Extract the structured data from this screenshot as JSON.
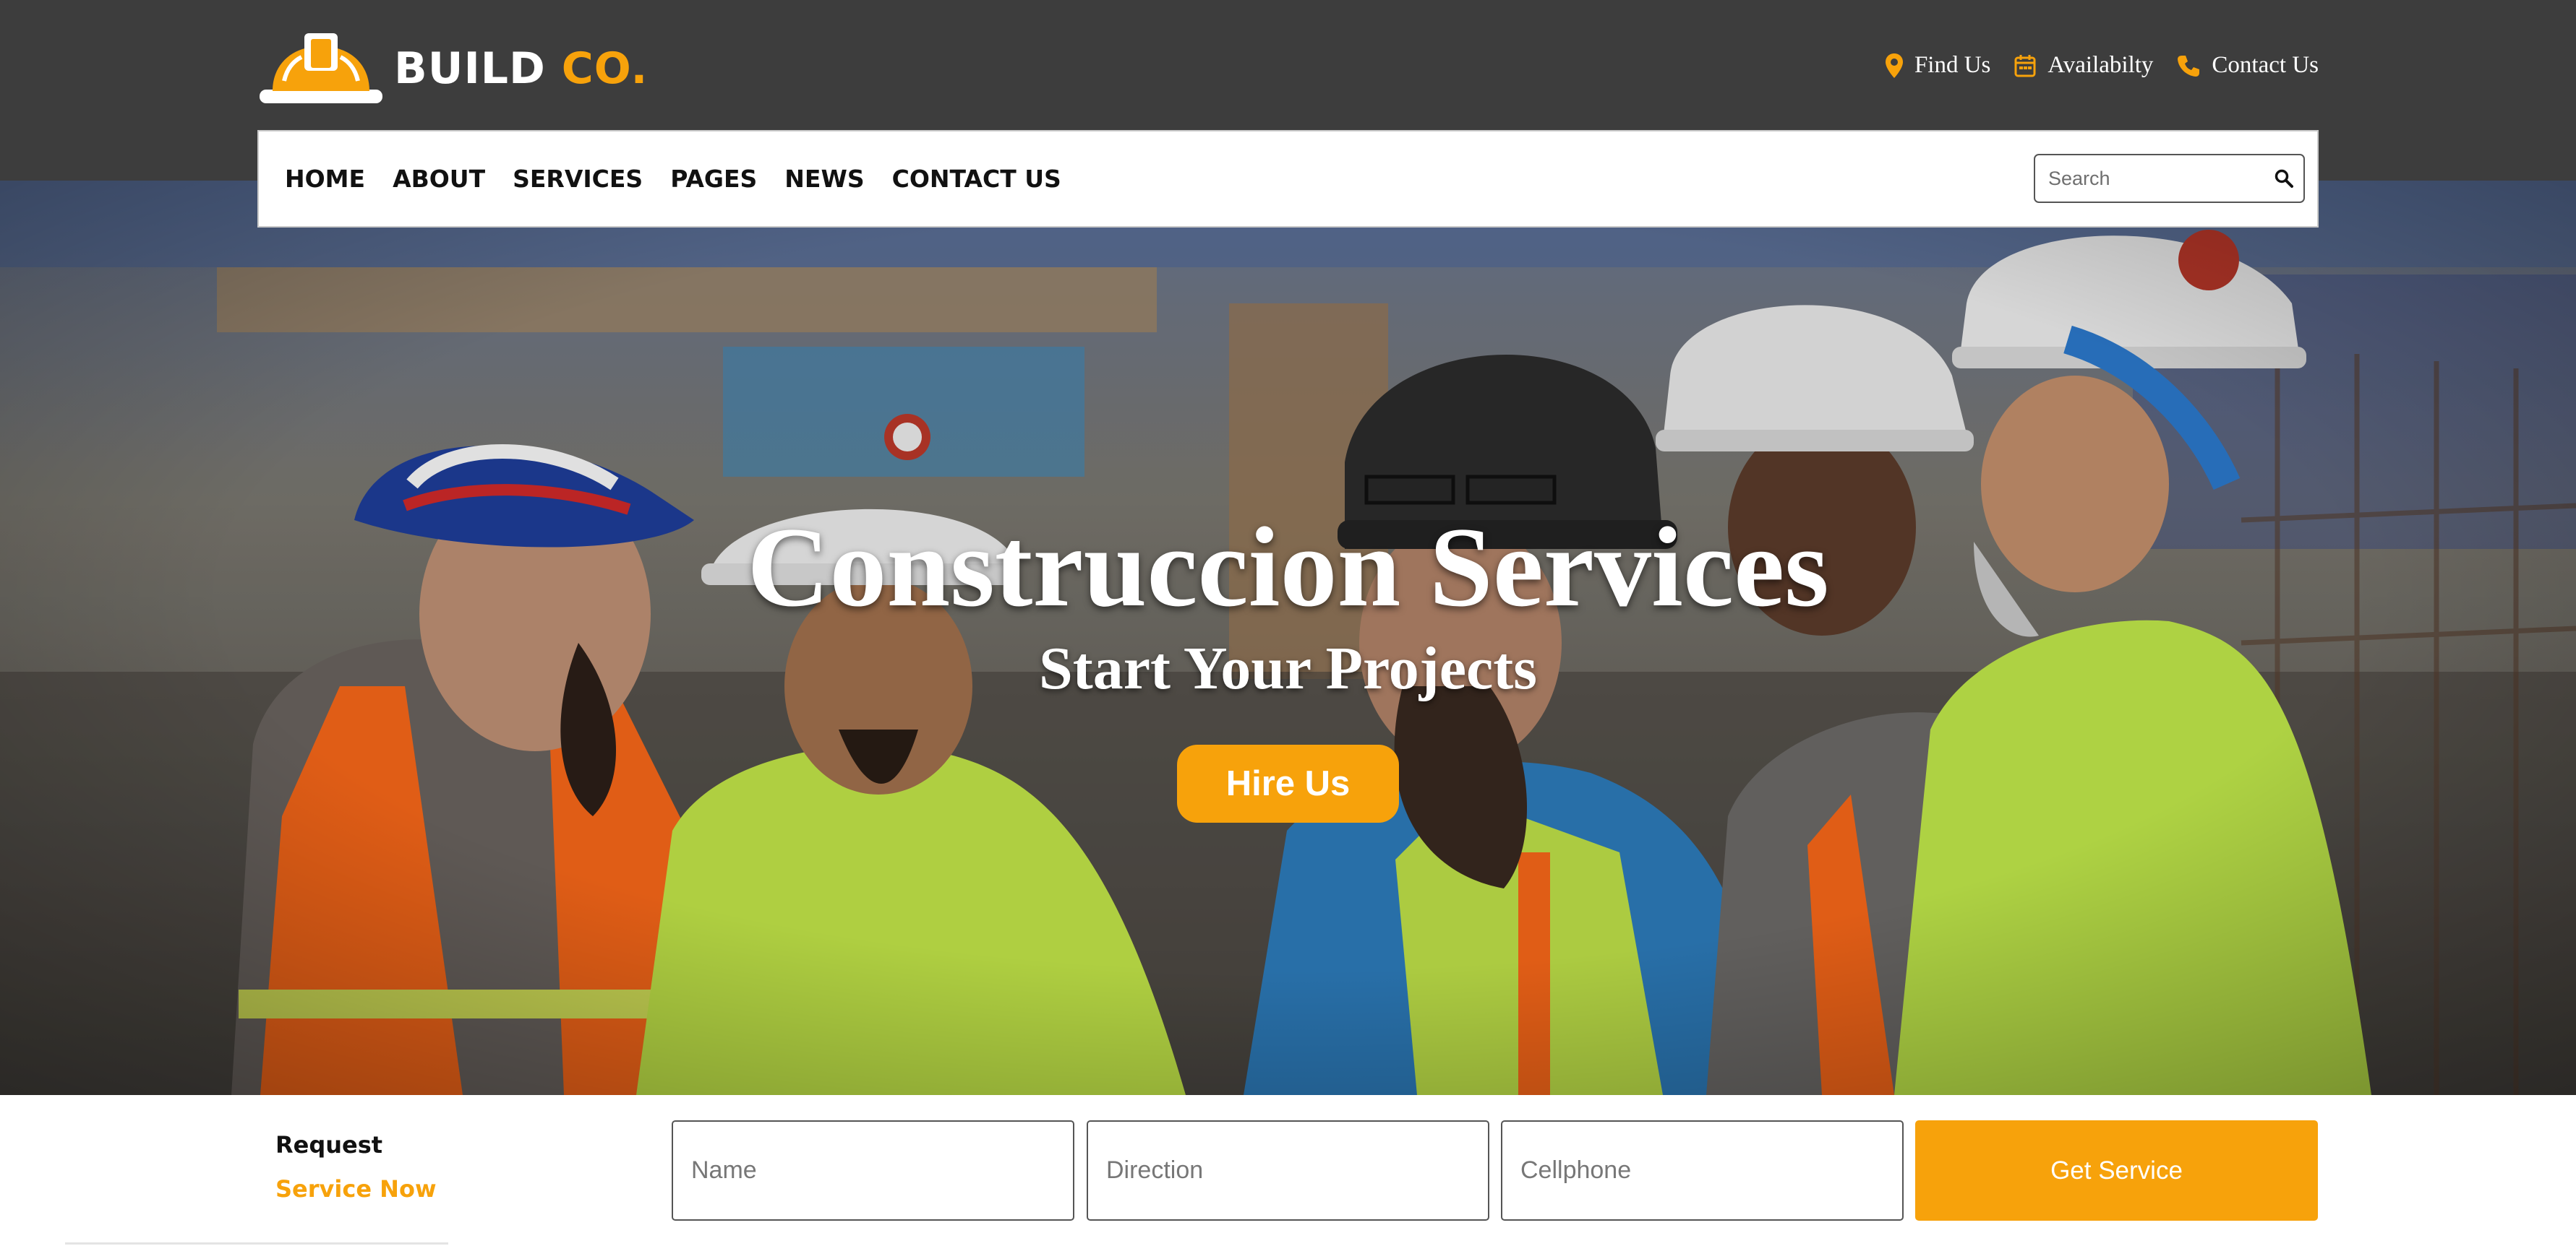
{
  "brand": {
    "name_white": "BUILD",
    "name_accent": "CO.",
    "accent_color": "#f7a20b",
    "topbar_color": "#3d3d3d"
  },
  "top_links": [
    {
      "label": "Find Us",
      "icon": "map-pin-icon"
    },
    {
      "label": "Availabilty",
      "icon": "calendar-icon"
    },
    {
      "label": "Contact Us",
      "icon": "phone-icon"
    }
  ],
  "nav": {
    "items": [
      "HOME",
      "ABOUT",
      "SERVICES",
      "PAGES",
      "NEWS",
      "CONTACT US"
    ],
    "search_placeholder": "Search",
    "search_icon": "search-icon"
  },
  "hero": {
    "title": "Construccion Services",
    "subtitle": "Start Your Projects",
    "cta": "Hire Us",
    "image": "construction-workers-photo"
  },
  "request": {
    "label": "Request",
    "label_accent": "Service Now",
    "fields": [
      {
        "placeholder": "Name",
        "value": ""
      },
      {
        "placeholder": "Direction",
        "value": ""
      },
      {
        "placeholder": "Cellphone",
        "value": ""
      }
    ],
    "submit": "Get Service"
  }
}
